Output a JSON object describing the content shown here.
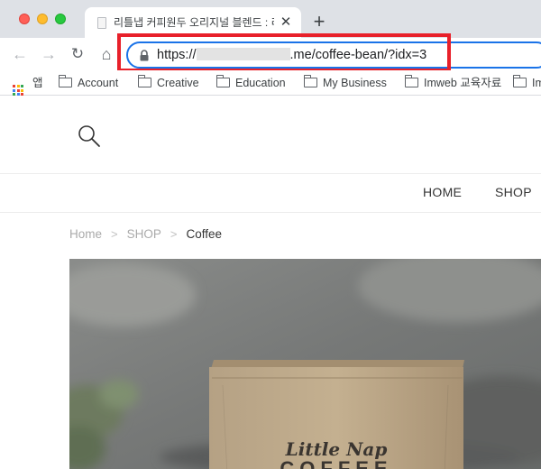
{
  "browser": {
    "tab": {
      "title": "리틀냅 커피원두 오리지널 블렌드 : 리틀냅 커피"
    },
    "new_tab_label": "+",
    "close_label": "✕",
    "nav": {
      "back_glyph": "←",
      "forward_glyph": "→",
      "reload_glyph": "↻",
      "home_glyph": "⌂"
    },
    "url": {
      "prefix": "https://",
      "suffix": ".me/coffee-bean/?idx=3"
    },
    "bookmarks": [
      {
        "label": "앱",
        "icon": "apps-grid-icon"
      },
      {
        "label": "Account",
        "icon": "folder-icon"
      },
      {
        "label": "Creative",
        "icon": "folder-icon"
      },
      {
        "label": "Education",
        "icon": "folder-icon"
      },
      {
        "label": "My Business",
        "icon": "folder-icon"
      },
      {
        "label": "Imweb 교육자료",
        "icon": "folder-icon"
      },
      {
        "label": "Im",
        "icon": "folder-icon"
      }
    ],
    "highlight_color": "#e8202a",
    "accent_color": "#1a73e8"
  },
  "site": {
    "nav": {
      "items": [
        "HOME",
        "SHOP"
      ]
    },
    "breadcrumb": {
      "items": [
        "Home",
        "SHOP",
        "Coffee"
      ],
      "separator": ">"
    },
    "product_image": {
      "brand_text": "Little Nap",
      "label_text": "COFFEE"
    }
  }
}
